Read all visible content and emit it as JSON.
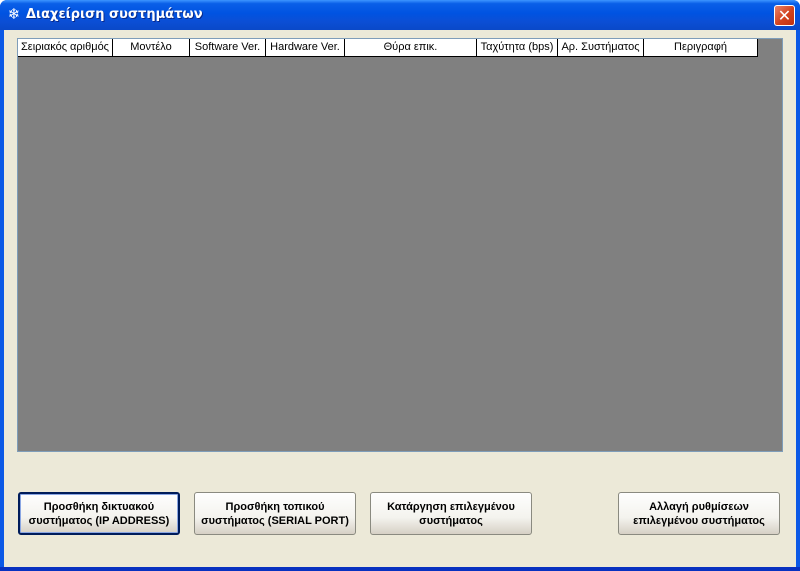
{
  "window": {
    "title": "Διαχείριση συστημάτων",
    "icon": "snowflake-icon",
    "close_label": "✕"
  },
  "table": {
    "columns": [
      "Σειριακός αριθμός",
      "Μοντέλο",
      "Software Ver.",
      "Hardware Ver.",
      "Θύρα επικ.",
      "Ταχύτητα (bps)",
      "Αρ. Συστήματος",
      "Περιγραφή"
    ],
    "rows": []
  },
  "buttons": {
    "add_network": "Προσθήκη δικτυακού\nσυστήματος (IP ADDRESS)",
    "add_local": "Προσθήκη τοπικού\nσυστήματος (SERIAL PORT)",
    "remove_selected": "Κατάργηση επιλεγμένου\nσυστήματος",
    "change_settings": "Αλλαγή ρυθμίσεων\nεπιλεγμένου συστήματος"
  },
  "colors": {
    "titlebar": "#0053e1",
    "client_bg": "#ece9d8",
    "list_bg": "#808080",
    "close": "#d2421d"
  }
}
